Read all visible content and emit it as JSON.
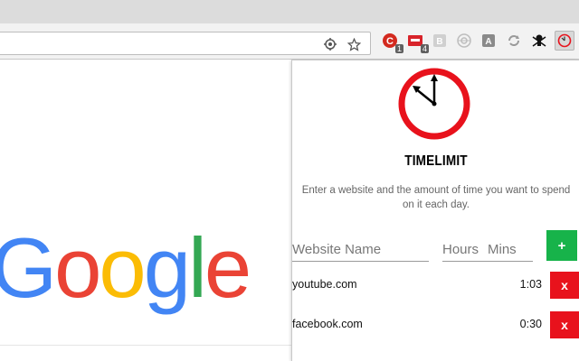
{
  "browser": {
    "extensions": [
      {
        "name": "extension-1",
        "badge": "1",
        "color": "#d32a1f"
      },
      {
        "name": "extension-2",
        "badge": "4",
        "color": "#d8232a"
      },
      {
        "name": "extension-3",
        "color": "#bdbdbd"
      },
      {
        "name": "extension-4",
        "color": "#bdbdbd"
      },
      {
        "name": "extension-5",
        "color": "#8a8a8a"
      },
      {
        "name": "extension-6",
        "color": "#9a9a9a"
      },
      {
        "name": "extension-7",
        "color": "#111111"
      },
      {
        "name": "timelimit-extension",
        "color": "#e8121c"
      }
    ]
  },
  "page": {
    "logo_letters": [
      "G",
      "o",
      "o",
      "g",
      "l",
      "e"
    ]
  },
  "popup": {
    "brand": "TIMELIMIT",
    "instructions": "Enter a website and the amount of time you want to spend on it each day.",
    "form": {
      "website_placeholder": "Website Name",
      "hours_placeholder": "Hours",
      "mins_placeholder": "Mins",
      "add_label": "+"
    },
    "entries": [
      {
        "site": "youtube.com",
        "time": "1:03",
        "delete_label": "x"
      },
      {
        "site": "facebook.com",
        "time": "0:30",
        "delete_label": "x"
      }
    ],
    "colors": {
      "add_button": "#17b34a",
      "delete_button": "#e8121c",
      "clock_ring": "#e8121c"
    }
  }
}
